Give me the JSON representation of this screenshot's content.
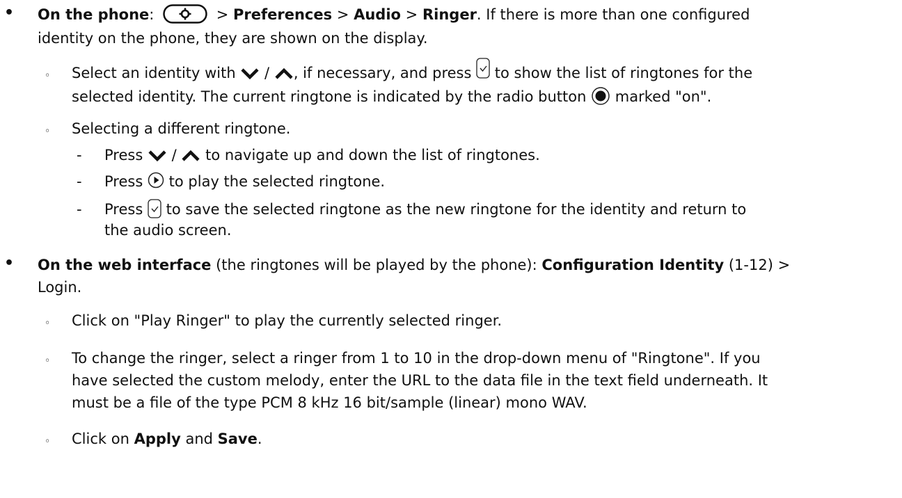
{
  "bullet1": {
    "lead": "On the phone",
    "colon": ":",
    "sep": ">",
    "path1": "Preferences",
    "path2": "Audio",
    "path3": "Ringer",
    "rest1": ". If there is more than one configured",
    "cont": "identity on the phone, they are shown on the display.",
    "sub1": {
      "a": "Select an identity with",
      "slash": "/",
      "b": ", if necessary, and press",
      "c": "to show the list of ringtones for the",
      "d": "selected identity. The current ringtone is indicated by the radio button",
      "e": "marked \"on\"."
    },
    "sub2": "Selecting a different ringtone.",
    "dash1": {
      "a": "Press",
      "slash": "/",
      "b": "to navigate up and down the list of ringtones."
    },
    "dash2": {
      "a": "Press",
      "b": "to play the selected ringtone."
    },
    "dash3": {
      "a": "Press",
      "b": "to save the selected ringtone as the new ringtone for the identity and return to",
      "c": "the audio screen."
    }
  },
  "bullet2": {
    "lead": "On the web interface",
    "rest1": " (the ringtones will be played by the phone): ",
    "path": "Configuration Identity",
    "rest2": " (1-12) >",
    "cont": "Login.",
    "sub1": "Click on \"Play Ringer\" to play the currently selected ringer.",
    "sub2_l1": "To change the ringer, select a ringer from 1 to 10 in the drop-down menu of \"Ringtone\". If you",
    "sub2_l2": "have selected the custom melody, enter the URL to the data file in the text field underneath. It",
    "sub2_l3": "must be a file of the type PCM 8 kHz 16 bit/sample (linear) mono WAV.",
    "sub3": {
      "a": "Click on ",
      "apply": "Apply",
      "and": " and ",
      "save": "Save",
      "end": "."
    }
  },
  "icons": [
    "settings-key-icon",
    "down-chevron-icon",
    "up-chevron-icon",
    "ok-check-icon",
    "radio-on-icon",
    "play-icon"
  ]
}
